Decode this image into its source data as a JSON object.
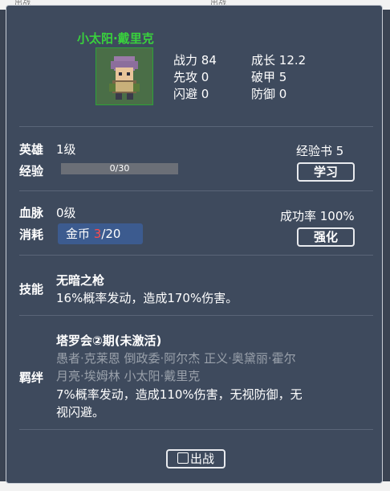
{
  "background": {
    "top_tabs": [
      "出战",
      "出战"
    ],
    "bottom_tabs": [
      "",
      ""
    ]
  },
  "hero": {
    "name": "小太阳·戴里克",
    "stats": [
      {
        "label": "战力",
        "value": "84"
      },
      {
        "label": "先攻",
        "value": "0"
      },
      {
        "label": "闪避",
        "value": "0"
      },
      {
        "label": "成长",
        "value": "12.2"
      },
      {
        "label": "破甲",
        "value": "5"
      },
      {
        "label": "防御",
        "value": "0"
      }
    ]
  },
  "level": {
    "hero_label": "英雄",
    "hero_level": "1级",
    "exp_label": "经验",
    "exp_text": "0/30",
    "exp_progress": 0,
    "exp_book": "经验书 5",
    "learn_button": "学习"
  },
  "bloodline": {
    "label": "血脉",
    "level": "0级",
    "cost_label": "消耗",
    "coin_label": "金币 ",
    "coin_have": "3",
    "coin_need": "/20",
    "success_rate": "成功率 100%",
    "enhance_button": "强化"
  },
  "skill": {
    "label": "技能",
    "name": "无暗之枪",
    "desc": "16%概率发动，造成170%伤害。"
  },
  "bond": {
    "label": "羁绊",
    "name": "塔罗会②期(未激活)",
    "members_line1": "愚者·克莱恩  倒政委·阿尔杰  正义·奥黛丽·霍尔",
    "members_line2": "月亮·埃姆林  小太阳·戴里克",
    "effect_line1": "7%概率发动，造成110%伤害，无视防御，无",
    "effect_line2": "视闪避。"
  },
  "deploy_button": "出战",
  "colors": {
    "name_green": "#39d13d",
    "panel_bg": "#3e4a5d",
    "coin_bg": "#3c5b8f",
    "coin_red": "#ff4a4a"
  }
}
